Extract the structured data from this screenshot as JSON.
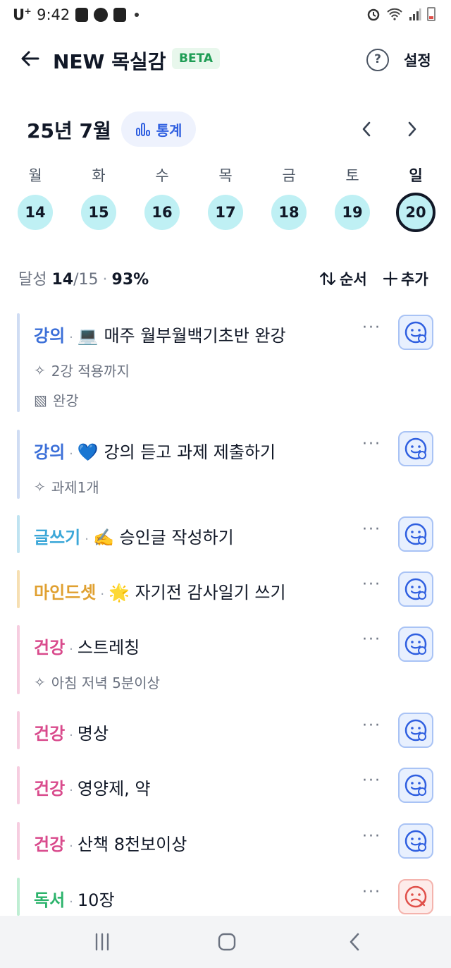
{
  "statusbar": {
    "carrier": "U",
    "carrier_sup": "+",
    "time": "9:42"
  },
  "header": {
    "title": "NEW 목실감",
    "badge": "BETA",
    "help": "?",
    "settings": "설정"
  },
  "month": {
    "label": "25년 7월",
    "stats": "통계"
  },
  "week": {
    "days": [
      "월",
      "화",
      "수",
      "목",
      "금",
      "토",
      "일"
    ],
    "dates": [
      "14",
      "15",
      "16",
      "17",
      "18",
      "19",
      "20"
    ]
  },
  "summary": {
    "label": "달성",
    "done": "14",
    "total": "/15",
    "percent": "93%",
    "order": "순서",
    "add": "추가"
  },
  "tasks": [
    {
      "category": "강의",
      "emoji": "💻",
      "text": "매주 월부월백기초반 완강",
      "sub1": "2강 적용까지",
      "sub2": "완강",
      "status": "done"
    },
    {
      "category": "강의",
      "emoji": "💙",
      "text": "강의 듣고 과제 제출하기",
      "sub1": "과제1개",
      "status": "done"
    },
    {
      "category": "글쓰기",
      "emoji": "✍️",
      "text": "승인글 작성하기",
      "status": "done"
    },
    {
      "category": "마인드셋",
      "emoji": "🌟",
      "text": "자기전 감사일기 쓰기",
      "status": "done"
    },
    {
      "category": "건강",
      "text": "스트레칭",
      "sub1": "아침 저녁 5분이상",
      "status": "done"
    },
    {
      "category": "건강",
      "text": "명상",
      "status": "done"
    },
    {
      "category": "건강",
      "text": "영양제, 약",
      "status": "done"
    },
    {
      "category": "건강",
      "text": "산책 8천보이상",
      "status": "done"
    },
    {
      "category": "독서",
      "text": "10장",
      "status": "failed"
    }
  ],
  "colors": {
    "lecture": "#3b6fd8",
    "writing": "#3ba7d8",
    "mindset": "#e0a030",
    "health": "#d94a8c",
    "reading": "#2bb36b",
    "accent": "#2f5fe0"
  }
}
